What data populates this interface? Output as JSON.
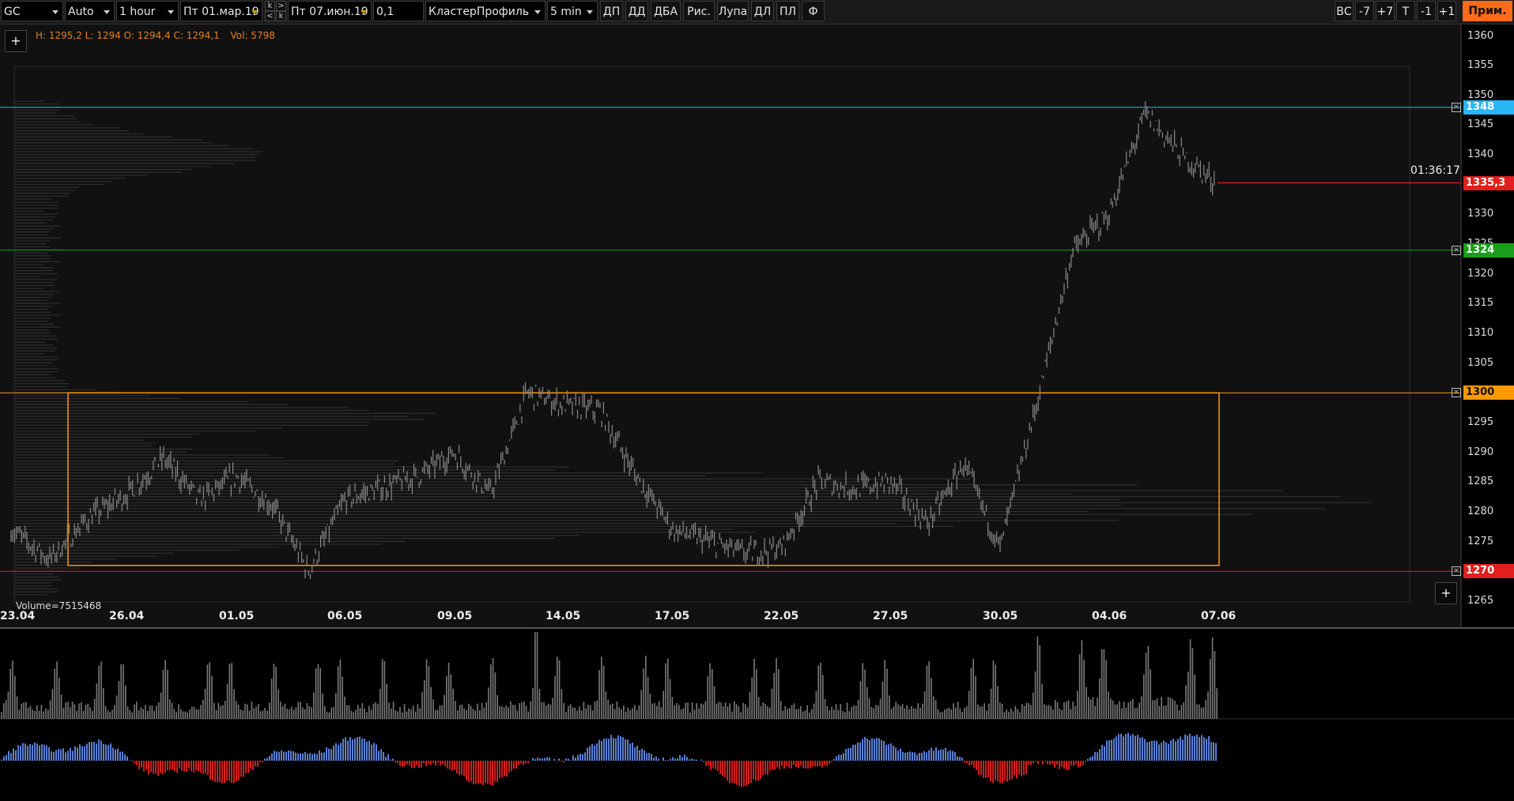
{
  "toolbar": {
    "symbol": "GC",
    "scale_mode": "Auto",
    "timeframe": "1 hour",
    "date_from": "Пт 01.мар.19",
    "date_to": "Пт 07.июн.19",
    "tick_size": "0,1",
    "chart_type": "КластерПрофиль",
    "cluster_period": "5 min",
    "nav_buttons": [
      "k",
      ">",
      "<",
      "k"
    ],
    "buttons": [
      "ДП",
      "ДД",
      "ДБА",
      "Рис.",
      "Лупа",
      "ДЛ",
      "ПЛ",
      "Ф"
    ],
    "right_buttons": [
      "ВС",
      "-7",
      "+7",
      "T",
      "-1",
      "+1"
    ],
    "apply_label": "Прим."
  },
  "info_bar": {
    "ohlc": "H: 1295,2 L: 1294 O: 1294,4 C: 1294,1",
    "volume": "Vol: 5798"
  },
  "add_button_label": "+",
  "volume_total": "Volume=7515468",
  "timer": "01:36:17",
  "colors": {
    "background": "#000000",
    "chart_bg": "#111111",
    "candle": "#8a8a8a",
    "orange": "#ff9900",
    "blue": "#29b6f6",
    "green": "#1b9e1b",
    "red": "#e31e1e",
    "delta_pos": "#5b7fd4",
    "delta_neg": "#d41e1e"
  },
  "chart_data": {
    "type": "line",
    "x_ticks": [
      "23.04",
      "26.04",
      "01.05",
      "06.05",
      "09.05",
      "14.05",
      "17.05",
      "22.05",
      "27.05",
      "30.05",
      "04.06",
      "07.06"
    ],
    "y_ticks": [
      1265,
      1270,
      1275,
      1280,
      1285,
      1290,
      1295,
      1300,
      1305,
      1310,
      1315,
      1320,
      1325,
      1330,
      1335,
      1340,
      1345,
      1350,
      1355,
      1360
    ],
    "ylim": [
      1263,
      1361
    ],
    "last_price": "1335,3",
    "levels": [
      {
        "label": "1348",
        "value": 1348,
        "color": "#29b6f6"
      },
      {
        "label": "1324",
        "value": 1324,
        "color": "#1b9e1b"
      },
      {
        "label": "1300",
        "value": 1300,
        "color": "#ff9900"
      },
      {
        "label": "1270",
        "value": 1270,
        "color": "#e31e1e"
      }
    ],
    "box": {
      "x_start": "24.04",
      "x_end": "07.06",
      "y_low": 1271,
      "y_high": 1300
    },
    "price_series": [
      {
        "date": "23.04",
        "value": 1277
      },
      {
        "date": "24.04",
        "value": 1272
      },
      {
        "date": "25.04",
        "value": 1279
      },
      {
        "date": "26.04",
        "value": 1283
      },
      {
        "date": "29.04",
        "value": 1289
      },
      {
        "date": "30.04",
        "value": 1282
      },
      {
        "date": "01.05",
        "value": 1286
      },
      {
        "date": "02.05",
        "value": 1281
      },
      {
        "date": "03.05",
        "value": 1270
      },
      {
        "date": "06.05",
        "value": 1282
      },
      {
        "date": "07.05",
        "value": 1284
      },
      {
        "date": "08.05",
        "value": 1286
      },
      {
        "date": "09.05",
        "value": 1290
      },
      {
        "date": "10.05",
        "value": 1283
      },
      {
        "date": "13.05",
        "value": 1300
      },
      {
        "date": "14.05",
        "value": 1298
      },
      {
        "date": "15.05",
        "value": 1297
      },
      {
        "date": "16.05",
        "value": 1286
      },
      {
        "date": "17.05",
        "value": 1277
      },
      {
        "date": "20.05",
        "value": 1275
      },
      {
        "date": "21.05",
        "value": 1273
      },
      {
        "date": "22.05",
        "value": 1274
      },
      {
        "date": "23.05",
        "value": 1285
      },
      {
        "date": "24.05",
        "value": 1284
      },
      {
        "date": "27.05",
        "value": 1285
      },
      {
        "date": "28.05",
        "value": 1278
      },
      {
        "date": "29.05",
        "value": 1288
      },
      {
        "date": "30.05",
        "value": 1274
      },
      {
        "date": "31.05",
        "value": 1298
      },
      {
        "date": "03.06",
        "value": 1324
      },
      {
        "date": "04.06",
        "value": 1330
      },
      {
        "date": "05.06",
        "value": 1347
      },
      {
        "date": "06.06",
        "value": 1340
      },
      {
        "date": "07.06",
        "value": 1335.3
      }
    ]
  }
}
